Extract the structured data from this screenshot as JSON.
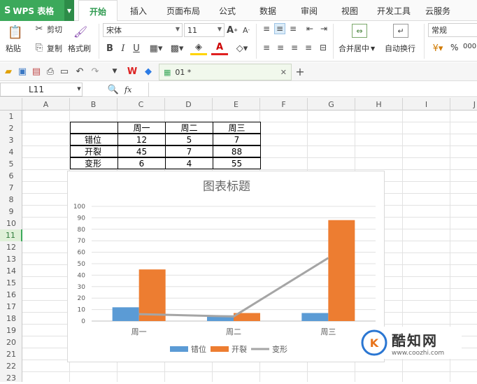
{
  "app": {
    "name": "WPS 表格"
  },
  "tabs": [
    "开始",
    "插入",
    "页面布局",
    "公式",
    "数据",
    "审阅",
    "视图",
    "开发工具",
    "云服务"
  ],
  "active_tab": "开始",
  "ribbon": {
    "paste": "粘贴",
    "cut": "剪切",
    "copy": "复制",
    "format_painter": "格式刷",
    "font_name": "宋体",
    "font_size": "11",
    "merge_center": "合并居中",
    "wrap_text": "自动换行",
    "number_format": "常规",
    "percent": "%"
  },
  "document": {
    "tab_label": "01 *"
  },
  "formula_bar": {
    "cell_ref": "L11",
    "fx": "fx",
    "value": ""
  },
  "columns": [
    "A",
    "B",
    "C",
    "D",
    "E",
    "F",
    "G",
    "H",
    "I",
    "J"
  ],
  "rows": [
    "1",
    "2",
    "3",
    "4",
    "5",
    "6",
    "7",
    "8",
    "9",
    "10",
    "11",
    "12",
    "13",
    "14",
    "15",
    "16",
    "17",
    "18",
    "19",
    "20",
    "21",
    "22",
    "23"
  ],
  "active_row": "11",
  "table": {
    "headers": [
      "",
      "周一",
      "周二",
      "周三"
    ],
    "rows": [
      [
        "错位",
        "12",
        "5",
        "7"
      ],
      [
        "开裂",
        "45",
        "7",
        "88"
      ],
      [
        "变形",
        "6",
        "4",
        "55"
      ]
    ]
  },
  "chart_data": {
    "type": "bar",
    "title": "图表标题",
    "categories": [
      "周一",
      "周二",
      "周三"
    ],
    "series": [
      {
        "name": "错位",
        "type": "bar",
        "values": [
          12,
          5,
          7
        ],
        "color": "#5b9bd5"
      },
      {
        "name": "开裂",
        "type": "bar",
        "values": [
          45,
          7,
          88
        ],
        "color": "#ed7d31"
      },
      {
        "name": "变形",
        "type": "line",
        "values": [
          6,
          4,
          55
        ],
        "color": "#a5a5a5"
      }
    ],
    "ylim": [
      0,
      100
    ],
    "yticks": [
      0,
      10,
      20,
      30,
      40,
      50,
      60,
      70,
      80,
      90,
      100
    ],
    "grid": true,
    "legend": "bottom"
  },
  "watermark": {
    "name": "酷知网",
    "url": "www.coozhi.com"
  }
}
